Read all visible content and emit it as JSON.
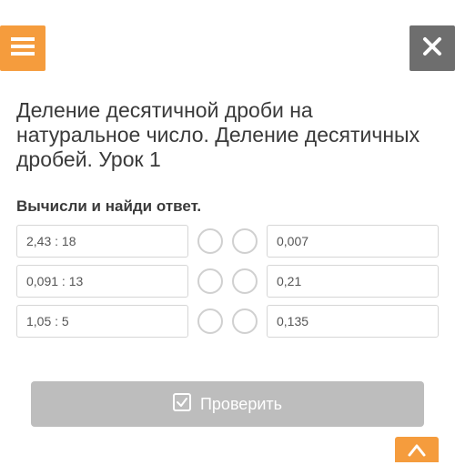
{
  "header": {
    "menu_icon": "hamburger-icon",
    "close_icon": "close-icon"
  },
  "lesson": {
    "title": "Деление десятичной дроби на натуральное число. Деление десятичных дробей. Урок 1",
    "instruction": "Вычисли и найди ответ."
  },
  "match": {
    "left": [
      "2,43 : 18",
      "0,091 : 13",
      "1,05 : 5"
    ],
    "right": [
      "0,007",
      "0,21",
      "0,135"
    ]
  },
  "actions": {
    "check_label": "Проверить"
  },
  "colors": {
    "accent": "#f59c3d",
    "neutral": "#6e6e6e",
    "disabled": "#bdbdbd"
  }
}
